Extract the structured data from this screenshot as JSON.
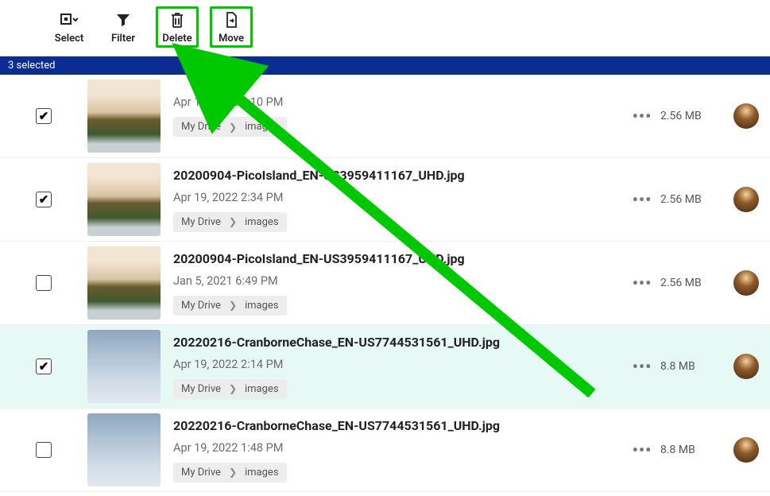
{
  "toolbar": {
    "select": "Select",
    "filter": "Filter",
    "delete": "Delete",
    "move": "Move"
  },
  "selection_bar": "3 selected",
  "crumb": {
    "root": "My Drive",
    "folder": "images"
  },
  "rows": [
    {
      "checked": true,
      "name": "",
      "date": "Apr 19, 2022 2:10 PM",
      "size": "2.56 MB",
      "thumb": "a",
      "selectedRow": false
    },
    {
      "checked": true,
      "name": "20200904-PicoIsland_EN-US3959411167_UHD.jpg",
      "date": "Apr 19, 2022 2:34 PM",
      "size": "2.56 MB",
      "thumb": "a",
      "selectedRow": false
    },
    {
      "checked": false,
      "name": "20200904-PicoIsland_EN-US3959411167_UHD.jpg",
      "date": "Jan 5, 2021 6:49 PM",
      "size": "2.56 MB",
      "thumb": "a",
      "selectedRow": false
    },
    {
      "checked": true,
      "name": "20220216-CranborneChase_EN-US7744531561_UHD.jpg",
      "date": "Apr 19, 2022 2:14 PM",
      "size": "8.8 MB",
      "thumb": "b",
      "selectedRow": true
    },
    {
      "checked": false,
      "name": "20220216-CranborneChase_EN-US7744531561_UHD.jpg",
      "date": "Apr 19, 2022 1:48 PM",
      "size": "8.8 MB",
      "thumb": "b",
      "selectedRow": false
    }
  ]
}
